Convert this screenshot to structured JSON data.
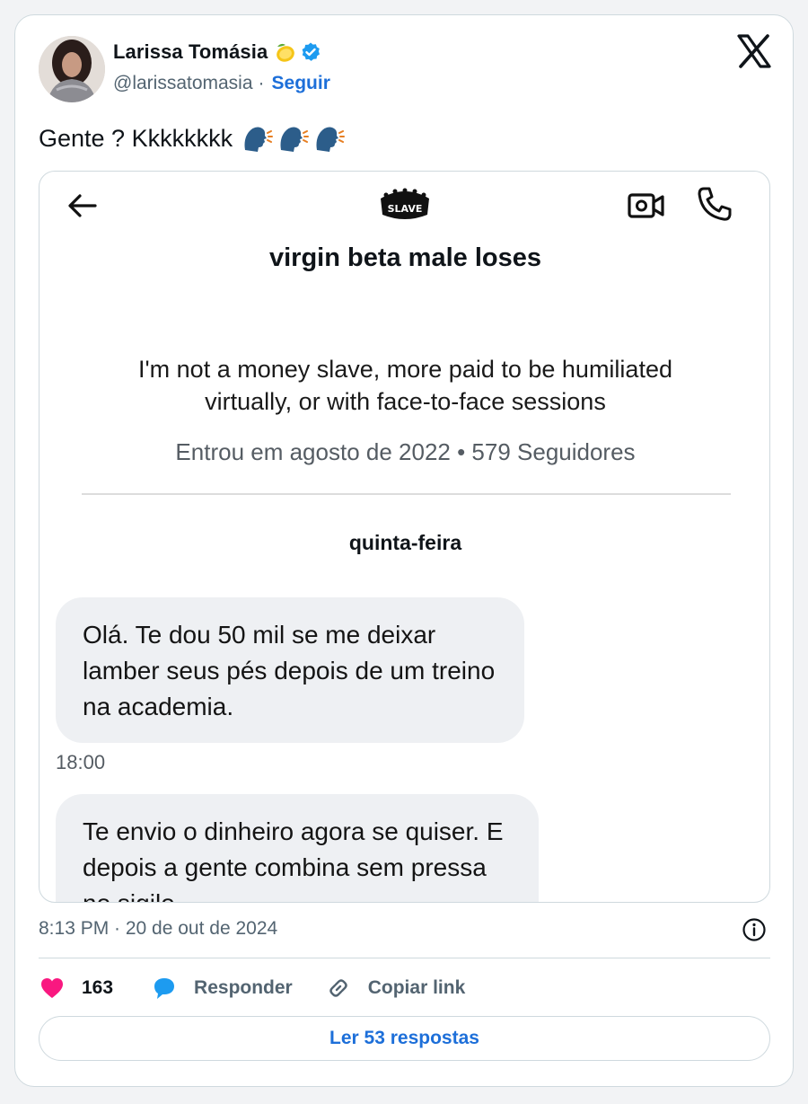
{
  "author": {
    "name": "Larissa Tomásia",
    "name_emoji": "lemon-emoji",
    "verified_icon": "verified-badge-icon",
    "handle": "@larissatomasia",
    "separator": "·",
    "follow_label": "Seguir"
  },
  "tweet": {
    "text": "Gente ? Kkkkkkkk",
    "emoji": "speaking-head-emoji"
  },
  "media": {
    "title": "virgin beta male loses",
    "bio_line1": "I'm not a money slave, more paid to be humiliated",
    "bio_line2": "virtually, or with face-to-face sessions",
    "meta": "Entrou em agosto de 2022 • 579 Seguidores",
    "day_label": "quinta-feira",
    "message1": "Olá.  Te dou 50 mil se me deixar lamber seus pés depois de um treino na academia.",
    "message1_time": "18:00",
    "message2": "Te envio o dinheiro agora se quiser. E depois a gente combina sem pressa no sigilo",
    "logo_text": "SLAVE"
  },
  "footer": {
    "timestamp": "8:13 PM · 20 de out de 2024",
    "likes": "163",
    "reply_label": "Responder",
    "copy_label": "Copiar link",
    "replies_button": "Ler 53 respostas"
  },
  "colors": {
    "accent": "#1d6fd9",
    "like": "#f91880",
    "reply_icon": "#1d9bf0",
    "bubble": "#eef0f3"
  }
}
